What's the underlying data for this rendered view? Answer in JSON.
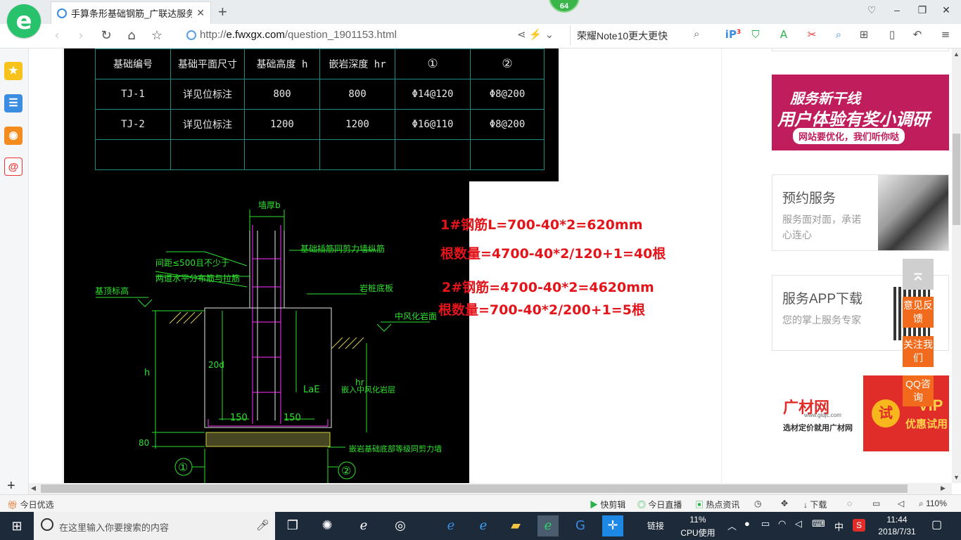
{
  "browser": {
    "tab_title": "手算条形基础钢筋_广联达服务新",
    "url_prefix": "http://",
    "url_host": "e.fwxgx.com",
    "url_path": "/question_1901153.html",
    "search_text": "荣耀Note10更大更快",
    "badge_count": "64",
    "toolbar_badge": "3"
  },
  "cad_table": {
    "header": [
      "基础编号",
      "基础平面尺寸",
      "基础高度 h",
      "嵌岩深度 hr",
      "①",
      "②"
    ],
    "rows": [
      [
        "TJ-1",
        "详见位标注",
        "800",
        "800",
        "Φ14@120",
        "Φ8@200"
      ],
      [
        "TJ-2",
        "详见位标注",
        "1200",
        "1200",
        "Φ16@110",
        "Φ8@200"
      ],
      [
        "",
        "",
        "",
        "",
        "",
        ""
      ]
    ]
  },
  "cad_drawing": {
    "labels": {
      "wall_thickness": "墙厚b",
      "anchor_note": "基础插筋同剪力墙纵筋",
      "spacing_note_1": "间距≤500且不少于",
      "spacing_note_2": "两道水平分布筋与拉筋",
      "elevation_label": "基顶标高",
      "base_label": "岩桩底板",
      "weathered_label": "中风化岩面",
      "lae": "LaE",
      "dim_150_left": "150",
      "dim_150_right": "150",
      "dim_h": "h",
      "dim_80": "80",
      "d20": "20d",
      "embed_label": "嵌入中风化岩层",
      "hr": "hr",
      "bottom_note": "嵌岩基础底部等级同剪力墙",
      "circle_1": "①",
      "circle_2": "②"
    }
  },
  "annotations": {
    "line1": "1#钢筋L=700-40*2=620mm",
    "line2": "根数量=4700-40*2/120+1=40根",
    "line3": "2#钢筋=4700-40*2=4620mm",
    "line4": "根数量=700-40*2/200+1=5根"
  },
  "right_column": {
    "ad1": {
      "headline": "服务新干线",
      "title": "用户体验有奖小调研",
      "subtitle": "网站要优化，我们听你哒"
    },
    "card1": {
      "title": "预约服务",
      "desc": "服务面对面，承诺心连心"
    },
    "card2": {
      "title": "服务APP下载",
      "desc": "您的掌上服务专家"
    },
    "ad2": {
      "brand": "广材网",
      "domain": "www.gldjc.com",
      "tagline": "选材定价就用广材网",
      "trial": "试",
      "vip": "VIP",
      "vip_sub": "优惠试用"
    },
    "float": {
      "feedback": "意见反馈",
      "follow": "关注我们",
      "qq": "QQ咨询"
    }
  },
  "statusbar": {
    "left": "今日优选",
    "items": [
      "快剪辑",
      "今日直播",
      "热点资讯",
      "下载"
    ],
    "zoom": "110%"
  },
  "taskbar": {
    "search_placeholder": "在这里输入你要搜索的内容",
    "link_label": "链接",
    "cpu_percent": "11%",
    "cpu_label": "CPU使用",
    "ime": "中",
    "time": "11:44",
    "date": "2018/7/31"
  },
  "colors": {
    "cad_background": "#000000",
    "annotation_red": "#e4141b",
    "float_orange": "#f26a1b",
    "taskbar": "#1d2a3a"
  }
}
